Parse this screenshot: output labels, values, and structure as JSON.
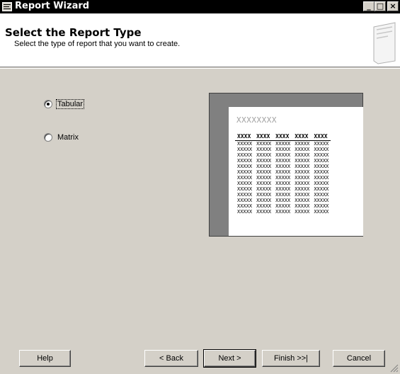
{
  "window": {
    "title": "Report Wizard"
  },
  "header": {
    "title": "Select the Report Type",
    "subtitle": "Select the type of report that you want to create."
  },
  "options": [
    {
      "label": "Tabular",
      "selected": true
    },
    {
      "label": "Matrix",
      "selected": false
    }
  ],
  "preview": {
    "title": "XXXXXXXX",
    "headers": [
      "XXXX",
      "XXXX",
      "XXXX",
      "XXXX",
      "XXXX"
    ],
    "cell": "XXXXX",
    "row_count": 13
  },
  "buttons": {
    "help": "Help",
    "back": "< Back",
    "next": "Next >",
    "finish": "Finish >>|",
    "cancel": "Cancel"
  },
  "icons": {
    "app": "report-icon",
    "header": "document-icon",
    "minimize": "minimize-icon",
    "maximize": "maximize-icon",
    "close": "close-icon"
  }
}
